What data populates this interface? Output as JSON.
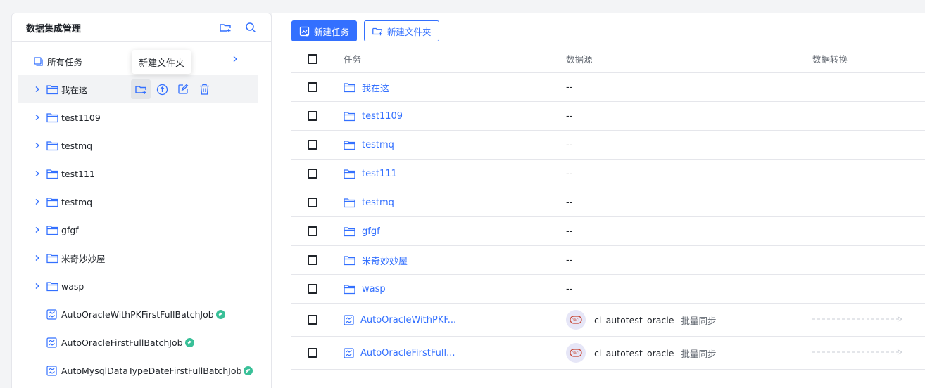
{
  "sidebar": {
    "title": "数据集成管理",
    "new_folder_icon": "folder-add-icon",
    "search_icon": "search-icon",
    "all_tasks_label": "所有任务",
    "tooltip": "新建文件夹",
    "folders": [
      "我在这",
      "test1109",
      "testmq",
      "test111",
      "testmq",
      "gfgf",
      "米奇妙妙屋",
      "wasp"
    ],
    "tasks": [
      "AutoOracleWithPKFirstFullBatchJob",
      "AutoOracleFirstFullBatchJob",
      "AutoMysqlDataTypeDateFirstFullBatchJob"
    ]
  },
  "toolbar": {
    "new_task_label": "新建任务",
    "new_folder_label": "新建文件夹"
  },
  "table": {
    "headers": {
      "task": "任务",
      "source": "数据源",
      "transform": "数据转换"
    },
    "rows": [
      {
        "name": "我在这",
        "kind": "folder",
        "source": "--"
      },
      {
        "name": "test1109",
        "kind": "folder",
        "source": "--"
      },
      {
        "name": "testmq",
        "kind": "folder",
        "source": "--"
      },
      {
        "name": "test111",
        "kind": "folder",
        "source": "--"
      },
      {
        "name": "testmq",
        "kind": "folder",
        "source": "--"
      },
      {
        "name": "gfgf",
        "kind": "folder",
        "source": "--"
      },
      {
        "name": "米奇妙妙屋",
        "kind": "folder",
        "source": "--"
      },
      {
        "name": "wasp",
        "kind": "folder",
        "source": "--"
      },
      {
        "name": "AutoOracleWithPKF...",
        "kind": "task",
        "source": "ci_autotest_oracle",
        "source_type": "批量同步",
        "logo": "ORCL"
      },
      {
        "name": "AutoOracleFirstFull...",
        "kind": "task",
        "source": "ci_autotest_oracle",
        "source_type": "批量同步",
        "logo": "ORCL"
      }
    ]
  },
  "colors": {
    "accent": "#3370ff",
    "success": "#39c098",
    "border": "#e5e6eb"
  }
}
